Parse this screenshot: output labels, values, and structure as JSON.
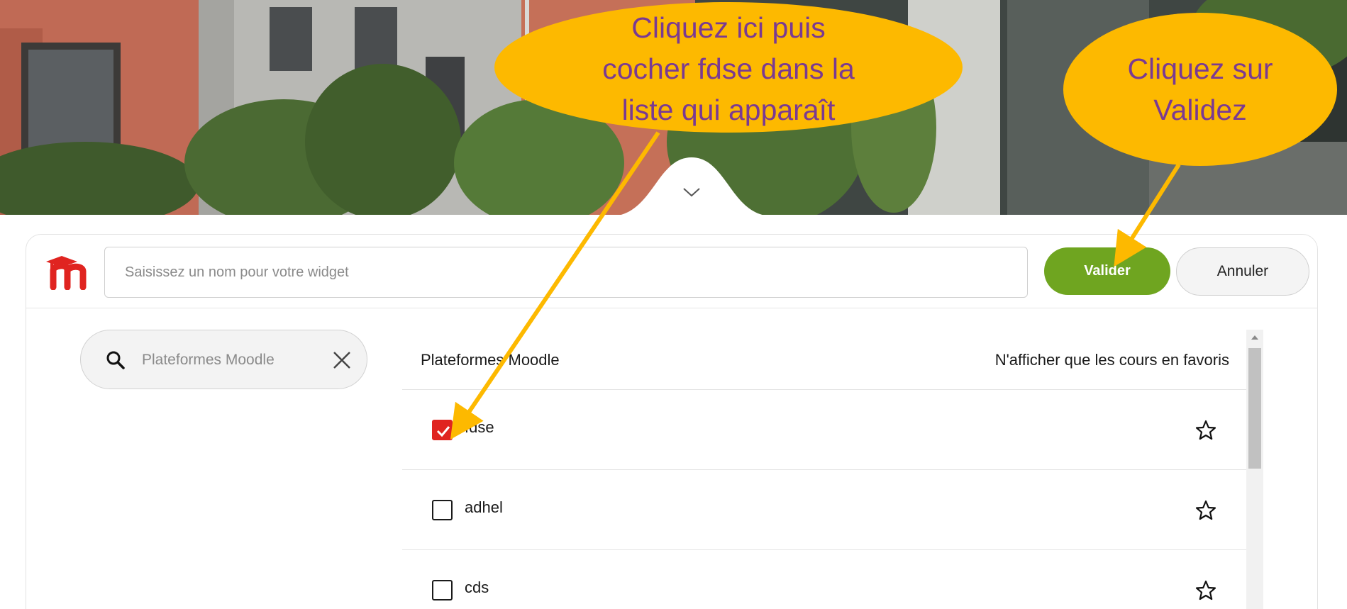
{
  "header": {
    "name_placeholder": "Saisissez un nom pour votre widget",
    "validate_label": "Valider",
    "cancel_label": "Annuler"
  },
  "search": {
    "placeholder": "Plateformes Moodle"
  },
  "list": {
    "title": "Plateformes Moodle",
    "favorites_filter": "N'afficher que les cours en favoris",
    "items": [
      {
        "label": "fdse",
        "checked": true
      },
      {
        "label": "adhel",
        "checked": false
      },
      {
        "label": "cds",
        "checked": false
      }
    ]
  },
  "annotations": {
    "callout_left": [
      "Cliquez ici puis",
      "cocher fdse dans la",
      "liste qui apparaît"
    ],
    "callout_right": [
      "Cliquez sur",
      "Validez"
    ],
    "color_fill": "#fdb900",
    "color_text": "#7a3a92"
  },
  "colors": {
    "validate_green": "#6fa520",
    "checkbox_red": "#e02420",
    "moodle_red": "#e02420"
  }
}
